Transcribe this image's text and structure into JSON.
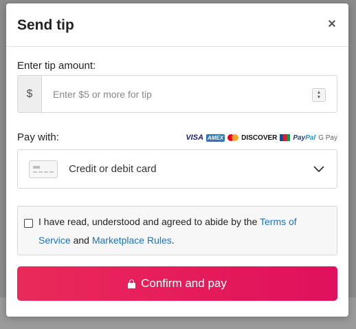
{
  "modal": {
    "title": "Send tip",
    "close_glyph": "×"
  },
  "tip": {
    "label": "Enter tip amount:",
    "currency": "$",
    "placeholder": "Enter $5 or more for tip"
  },
  "payment": {
    "label": "Pay with:",
    "logos": {
      "visa": "VISA",
      "amex": "AMEX",
      "discover": "DISCOVER",
      "paypal_pay": "Pay",
      "paypal_pal": "Pal",
      "gpay": "G Pay"
    },
    "selected_method": "Credit or debit card"
  },
  "terms": {
    "prefix": "I have read, understood and agreed to abide by the ",
    "tos_link": "Terms of Service",
    "and": " and ",
    "rules_link": "Marketplace Rules",
    "suffix": "."
  },
  "confirm_button": {
    "label": "Confirm and pay"
  }
}
